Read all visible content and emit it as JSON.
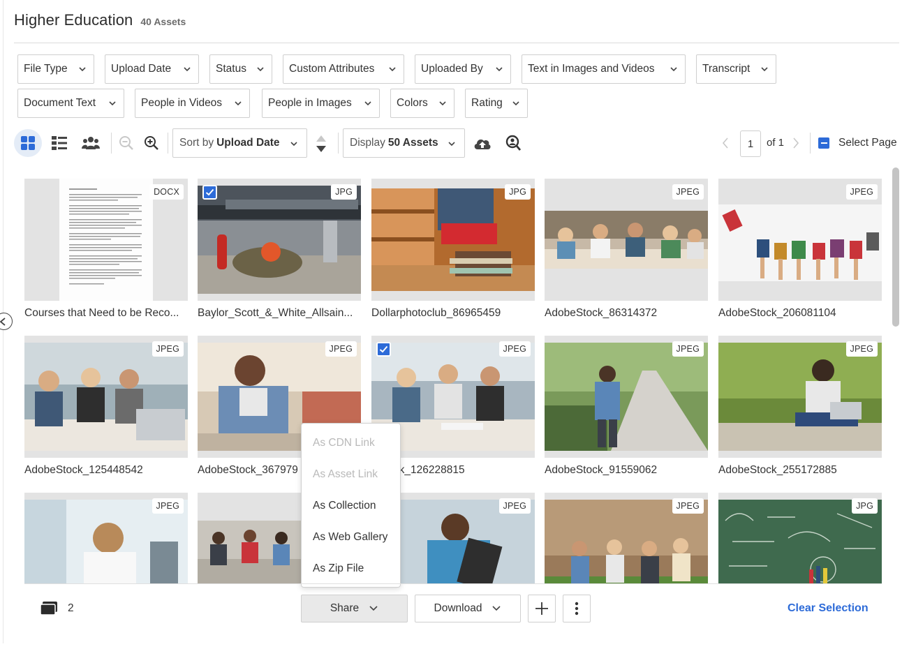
{
  "header": {
    "title": "Higher Education",
    "asset_count": "40 Assets"
  },
  "filters": [
    {
      "label": "File Type"
    },
    {
      "label": "Upload Date"
    },
    {
      "label": "Status"
    },
    {
      "label": "Custom Attributes"
    },
    {
      "label": "Uploaded By"
    },
    {
      "label": "Text in Images and Videos"
    },
    {
      "label": "Transcript"
    },
    {
      "label": "Document Text"
    },
    {
      "label": "People in Videos"
    },
    {
      "label": "People in Images"
    },
    {
      "label": "Colors"
    },
    {
      "label": "Rating"
    }
  ],
  "toolbar": {
    "sort_prefix": "Sort by",
    "sort_value": "Upload Date",
    "display_prefix": "Display",
    "display_value": "50 Assets",
    "page_current": "1",
    "page_total": "of 1",
    "select_page_label": "Select Page",
    "icons": [
      "grid-view-icon",
      "list-view-icon",
      "people-icon",
      "zoom-out-icon",
      "zoom-in-icon",
      "sort-order-icon",
      "upload-cloud-icon",
      "search-person-icon",
      "prev-page-icon",
      "next-page-icon"
    ]
  },
  "assets": [
    {
      "name": "Courses that Need to be Reco...",
      "type": "DOCX",
      "selected": false
    },
    {
      "name": "Baylor_Scott_&_White_Allsain...",
      "type": "JPG",
      "selected": true
    },
    {
      "name": "Dollarphotoclub_86965459",
      "type": "JPG",
      "selected": false
    },
    {
      "name": "AdobeStock_86314372",
      "type": "JPEG",
      "selected": false
    },
    {
      "name": "AdobeStock_206081104",
      "type": "JPEG",
      "selected": false
    },
    {
      "name": "AdobeStock_125448542",
      "type": "JPEG",
      "selected": false
    },
    {
      "name": "AdobeStock_367979",
      "type": "JPEG",
      "selected": false
    },
    {
      "name": "eStock_126228815",
      "type": "JPEG",
      "selected": true
    },
    {
      "name": "AdobeStock_91559062",
      "type": "JPEG",
      "selected": false
    },
    {
      "name": "AdobeStock_255172885",
      "type": "JPEG",
      "selected": false
    },
    {
      "name": "",
      "type": "JPEG",
      "selected": false
    },
    {
      "name": "",
      "type": "",
      "selected": false
    },
    {
      "name": "",
      "type": "JPEG",
      "selected": false
    },
    {
      "name": "",
      "type": "JPEG",
      "selected": false
    },
    {
      "name": "",
      "type": "JPG",
      "selected": false
    }
  ],
  "share_menu": {
    "items": [
      {
        "label": "As CDN Link",
        "enabled": false
      },
      {
        "label": "As Asset Link",
        "enabled": false
      },
      {
        "label": "As Collection",
        "enabled": true
      },
      {
        "label": "As Web Gallery",
        "enabled": true
      },
      {
        "label": "As Zip File",
        "enabled": true
      }
    ]
  },
  "footer": {
    "selected_count": "2",
    "share_label": "Share",
    "download_label": "Download",
    "clear_selection_label": "Clear Selection"
  },
  "colors": {
    "accent": "#2d6bd8",
    "border": "#cfcfcf"
  }
}
